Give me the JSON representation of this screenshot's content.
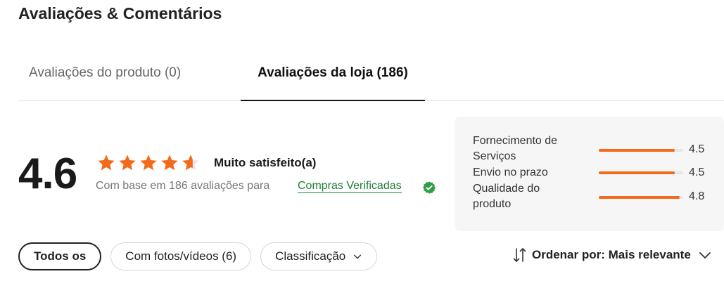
{
  "page": {
    "title": "Avaliações & Comentários"
  },
  "tabs": [
    {
      "label": "Avaliações do produto (0)",
      "active": false
    },
    {
      "label": "Avaliações da loja (186)",
      "active": true
    }
  ],
  "summary": {
    "score": "4.6",
    "stars": 4.6,
    "sentiment": "Muito satisfeito(a)",
    "based_on": "Com base em 186 avaliações para",
    "verified_link": "Compras Verificadas",
    "verified_icon": "verified-badge-icon"
  },
  "ratings": [
    {
      "label": "Fornecimento de Serviços",
      "value": "4.5",
      "fraction": 0.9
    },
    {
      "label": "Envio no prazo",
      "value": "4.5",
      "fraction": 0.9
    },
    {
      "label": "Qualidade do produto",
      "value": "4.8",
      "fraction": 0.96
    }
  ],
  "filters": [
    {
      "label": "Todos os",
      "active": true
    },
    {
      "label": "Com fotos/vídeos (6)",
      "active": false
    },
    {
      "label": "Classificação",
      "active": false,
      "dropdown": true
    }
  ],
  "sort": {
    "label": "Ordenar por: Mais relevante"
  },
  "colors": {
    "accent": "#f26a1b",
    "verified": "#1e7e34",
    "star": "#f26a1b"
  }
}
